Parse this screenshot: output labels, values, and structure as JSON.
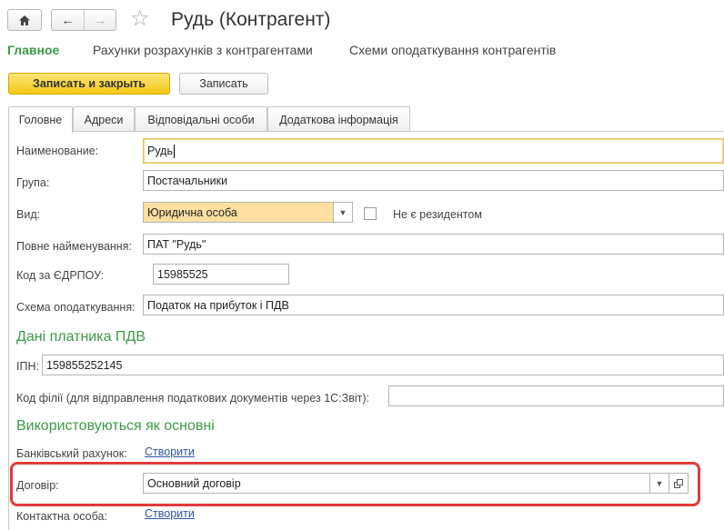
{
  "header": {
    "title": "Рудь (Контрагент)",
    "home_icon": "home-icon",
    "back_icon": "arrow-left-icon",
    "forward_icon": "arrow-right-icon",
    "favorite_icon": "star-icon"
  },
  "sections": [
    "Главное",
    "Рахунки розрахунків з контрагентами",
    "Схеми оподаткування контрагентів"
  ],
  "toolbar": {
    "save_close": "Записать и закрыть",
    "save": "Записать"
  },
  "tabs": [
    "Головне",
    "Адреси",
    "Відповідальні особи",
    "Додаткова інформація"
  ],
  "form": {
    "name_label": "Наименование:",
    "name_value": "Рудь",
    "group_label": "Група:",
    "group_value": "Постачальники",
    "kind_label": "Вид:",
    "kind_value": "Юридична особа",
    "nonresident_label": "Не є резидентом",
    "fullname_label": "Повне найменування:",
    "fullname_value": "ПАТ \"Рудь\"",
    "edrpou_label": "Код за ЄДРПОУ:",
    "edrpou_value": "15985525",
    "tax_scheme_label": "Схема оподаткування:",
    "tax_scheme_value": "Податок на прибуток і ПДВ"
  },
  "vat": {
    "header": "Дані платника ПДВ",
    "ipn_label": "ІПН:",
    "ipn_value": "159855252145",
    "branch_label": "Код філії (для відправлення податкових документів через 1С:Звіт):",
    "branch_value": ""
  },
  "defaults": {
    "header": "Використовуються як основні",
    "bank_label": "Банківський рахунок:",
    "bank_link": "Створити",
    "contract_label": "Договір:",
    "contract_value": "Основний договір",
    "contact_label": "Контактна особа:",
    "contact_link": "Створити"
  },
  "colors": {
    "accent_green": "#3b9b46",
    "primary_button": "#f4c814",
    "highlight_red": "#e23a3a"
  }
}
